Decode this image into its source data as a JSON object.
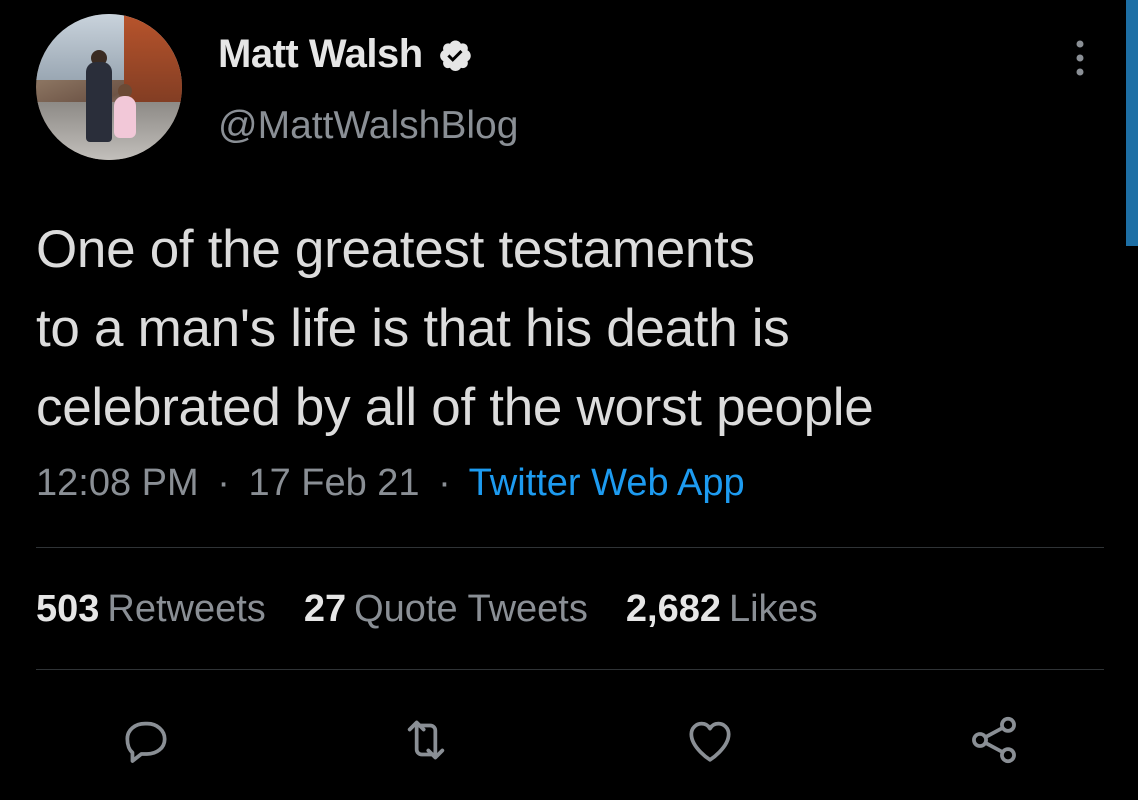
{
  "author": {
    "name": "Matt Walsh",
    "handle": "@MattWalshBlog"
  },
  "tweet": {
    "lines": [
      "One of the greatest testaments",
      "to a man's life is that his death is",
      "celebrated by all of the worst people"
    ],
    "time": "12:08 PM",
    "date": "17 Feb 21",
    "separator": "·",
    "source": "Twitter Web App"
  },
  "stats": {
    "retweets_count": "503",
    "retweets_label": "Retweets",
    "quotes_count": "27",
    "quotes_label": "Quote Tweets",
    "likes_count": "2,682",
    "likes_label": "Likes"
  },
  "icons": {
    "verified": "verified-badge-icon",
    "more": "more-vertical-icon",
    "reply": "reply-icon",
    "retweet": "retweet-icon",
    "like": "heart-icon",
    "share": "share-icon"
  },
  "colors": {
    "background": "#000000",
    "text": "#dcdcdc",
    "secondary": "#8a8f95",
    "link": "#1d9bf0"
  }
}
